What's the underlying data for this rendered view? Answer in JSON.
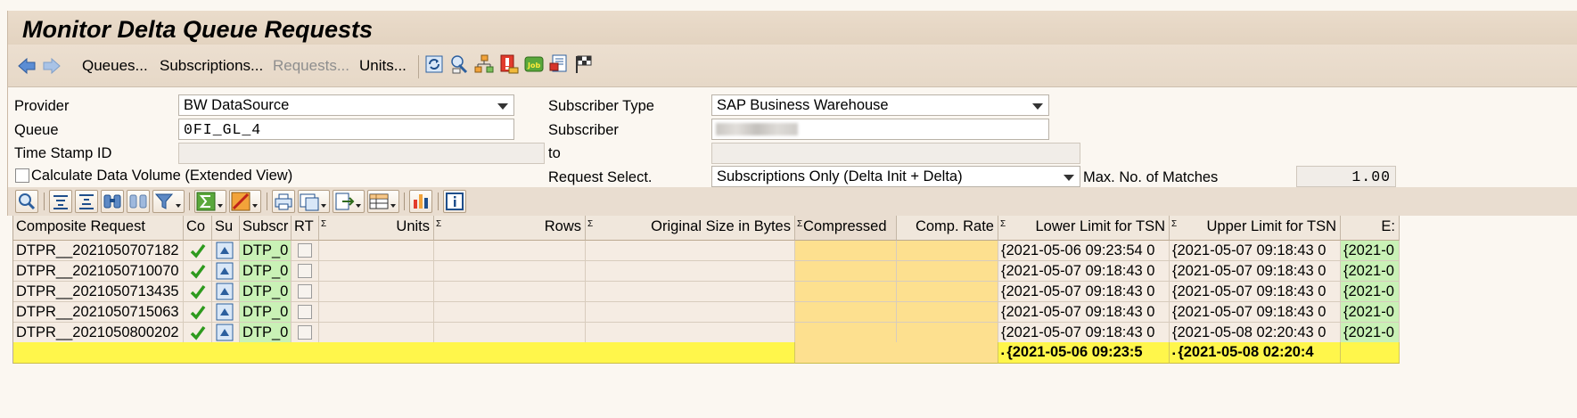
{
  "title": "Monitor Delta Queue Requests",
  "toolbar": {
    "queues": "Queues...",
    "subscriptions": "Subscriptions...",
    "requests": "Requests...",
    "units": "Units...",
    "icons": [
      "refresh-icon",
      "settings-icon",
      "hierarchy-icon",
      "warning-icon",
      "job-icon",
      "display-icon",
      "flag-icon"
    ]
  },
  "form": {
    "provider_label": "Provider",
    "provider_value": "BW DataSource",
    "queue_label": "Queue",
    "queue_value": "0FI_GL_4",
    "timestamp_label": "Time Stamp ID",
    "calc_label": "Calculate Data Volume (Extended View)",
    "subscriber_type_label": "Subscriber Type",
    "subscriber_type_value": "SAP Business Warehouse",
    "subscriber_label": "Subscriber",
    "to_label": "to",
    "request_select_label": "Request Select.",
    "request_select_value": "Subscriptions Only (Delta Init + Delta)",
    "max_matches_label": "Max. No. of Matches",
    "max_matches_value": "1.00"
  },
  "table": {
    "headers": {
      "composite": "Composite Request",
      "co": "Co",
      "su": "Su",
      "subscr": "Subscr",
      "rt": "RT",
      "units": "Units",
      "rows": "Rows",
      "orig_size": "Original Size in Bytes",
      "compressed": "Compressed",
      "comp_rate": "Comp. Rate",
      "lower": "Lower Limit for TSN",
      "upper": "Upper Limit for TSN",
      "ext": "E:"
    },
    "rows": [
      {
        "composite": "DTPR__2021050707182",
        "subscr": "DTP_0",
        "lower": "{2021-05-06 09:23:54 0",
        "upper": "{2021-05-07 09:18:43 0",
        "ext": "{2021-0"
      },
      {
        "composite": "DTPR__2021050710070",
        "subscr": "DTP_0",
        "lower": "{2021-05-07 09:18:43 0",
        "upper": "{2021-05-07 09:18:43 0",
        "ext": "{2021-0"
      },
      {
        "composite": "DTPR__2021050713435",
        "subscr": "DTP_0",
        "lower": "{2021-05-07 09:18:43 0",
        "upper": "{2021-05-07 09:18:43 0",
        "ext": "{2021-0"
      },
      {
        "composite": "DTPR__2021050715063",
        "subscr": "DTP_0",
        "lower": "{2021-05-07 09:18:43 0",
        "upper": "{2021-05-07 09:18:43 0",
        "ext": "{2021-0"
      },
      {
        "composite": "DTPR__2021050800202",
        "subscr": "DTP_0",
        "lower": "{2021-05-07 09:18:43 0",
        "upper": "{2021-05-08 02:20:43 0",
        "ext": "{2021-0"
      }
    ],
    "totals": {
      "lower": "{2021-05-06 09:23:5",
      "upper": "{2021-05-08 02:20:4"
    }
  },
  "colors": {
    "title_bg": "#e6d7c5",
    "total_row": "#fff64b",
    "compressed_col": "#fde08f",
    "subscr_col": "#c9f1b6"
  }
}
